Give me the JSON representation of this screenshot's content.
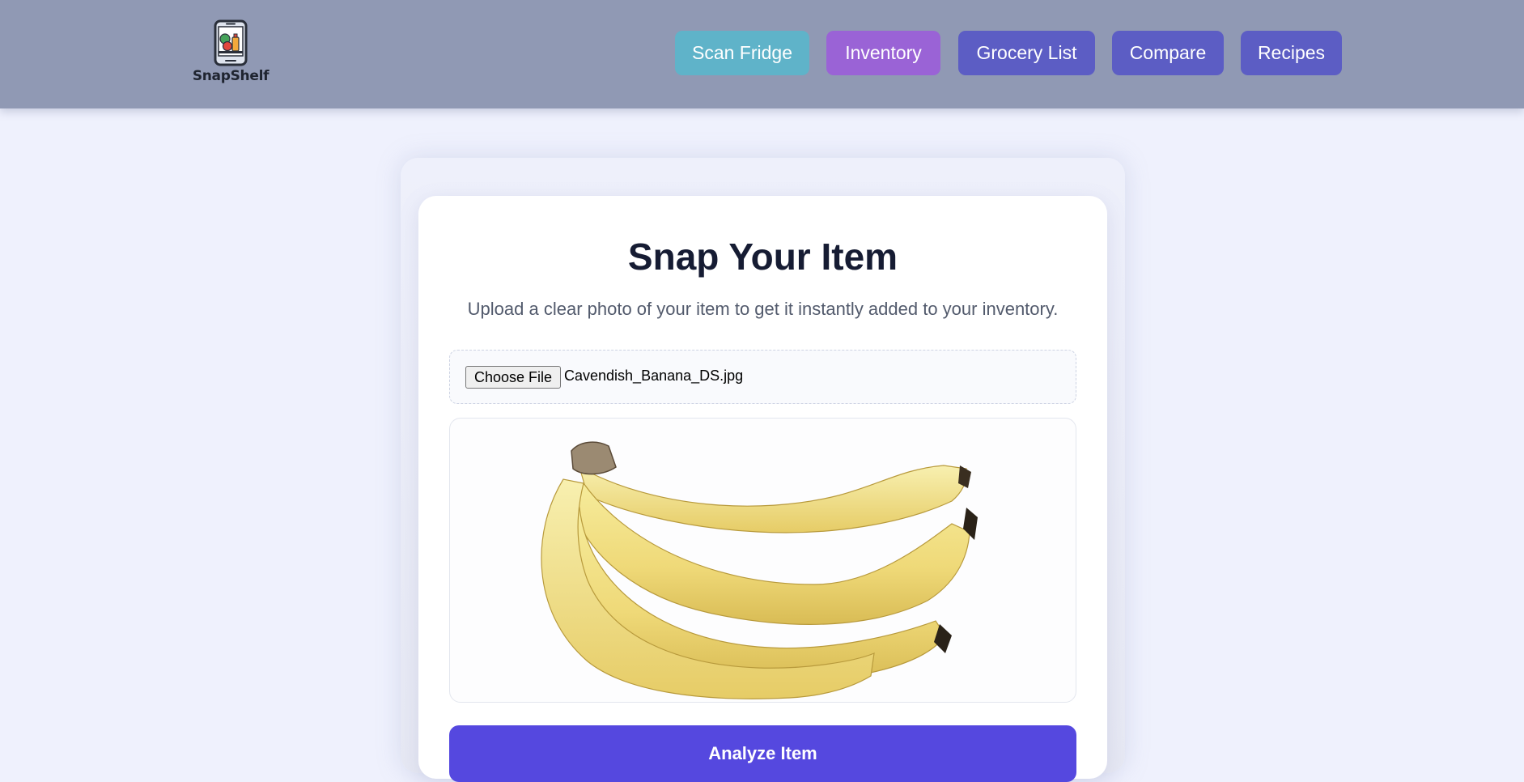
{
  "header": {
    "logo_text": "SnapShelf",
    "nav": [
      {
        "label": "Scan Fridge",
        "color": "#5fb3c9"
      },
      {
        "label": "Inventory",
        "color": "#9a63d6"
      },
      {
        "label": "Grocery List",
        "color": "#5c5dc4"
      },
      {
        "label": "Compare",
        "color": "#5c5dc4"
      },
      {
        "label": "Recipes",
        "color": "#5c5dc4"
      }
    ]
  },
  "card": {
    "title": "Snap Your Item",
    "subtitle": "Upload a clear photo of your item to get it instantly added to your inventory.",
    "file_button_label": "Choose File",
    "file_name": "Cavendish_Banana_DS.jpg",
    "preview_icon": "banana-bunch-image",
    "analyze_label": "Analyze Item"
  },
  "colors": {
    "header_bg": "#9099b4",
    "page_bg": "#eff1fd",
    "primary": "#5548df",
    "title_text": "#161c33"
  }
}
